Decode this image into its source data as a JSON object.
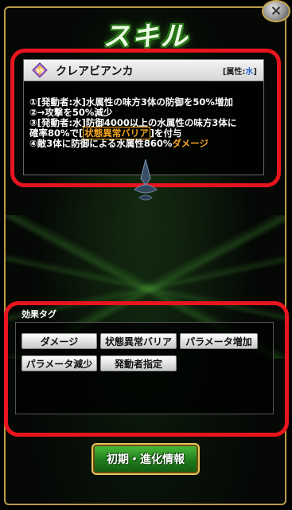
{
  "screen": {
    "title": "スキル",
    "close_label": "×"
  },
  "skill": {
    "name": "クレアビアンカ",
    "attribute_label": "[属性:",
    "attribute_value": "水",
    "attribute_close": "]",
    "icon": "ss-skill-icon",
    "lines": [
      {
        "parts": [
          "①[発動者:水]水属性の味方3体の防御を50%増加"
        ]
      },
      {
        "parts": [
          "②→攻撃を50%減少"
        ]
      },
      {
        "parts": [
          "③[発動者:水]防御4000以上の水属性の味方3体に"
        ]
      },
      {
        "pre": "確率80%で[",
        "highlight": "状態異常バリア",
        "post": "]を付与"
      },
      {
        "pre": "④敵3体に防御による水属性860%",
        "accent": "ダメージ"
      }
    ]
  },
  "tags": {
    "heading": "効果タグ",
    "items": [
      "ダメージ",
      "状態異常バリア",
      "パラメータ増加",
      "パラメータ減少",
      "発動者指定"
    ]
  },
  "footer": {
    "info_button": "初期・進化情報"
  },
  "colors": {
    "highlight": "#f5a623",
    "annotation_ring": "#e8151f",
    "frame_gold": "#b89a4a",
    "button_green": "#1f7a1c"
  }
}
